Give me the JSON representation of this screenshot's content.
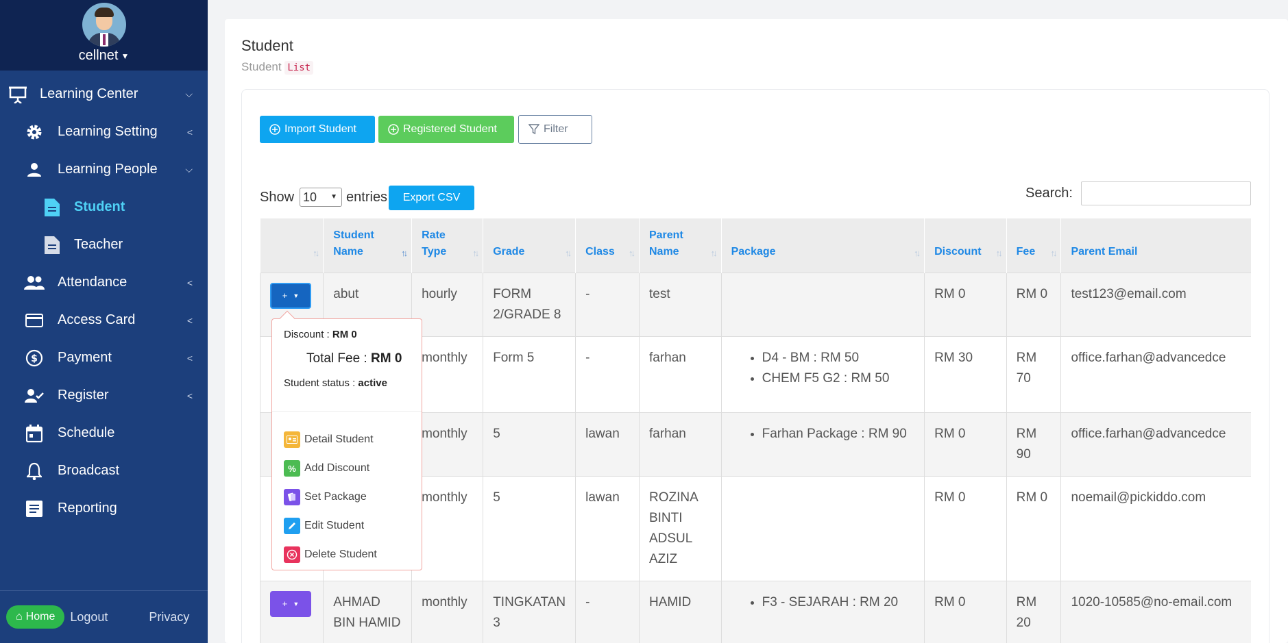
{
  "sidebar": {
    "username": "cellnet",
    "items": [
      {
        "label": "Learning Center"
      },
      {
        "label": "Learning Setting"
      },
      {
        "label": "Learning People"
      },
      {
        "label": "Student"
      },
      {
        "label": "Teacher"
      },
      {
        "label": "Attendance"
      },
      {
        "label": "Access Card"
      },
      {
        "label": "Payment"
      },
      {
        "label": "Register"
      },
      {
        "label": "Schedule"
      },
      {
        "label": "Broadcast"
      },
      {
        "label": "Reporting"
      }
    ],
    "home_label": "Home",
    "logout_label": "Logout",
    "privacy_label": "Privacy",
    "accent_color": "#4fd1f5"
  },
  "page": {
    "title": "Student",
    "subtitle_prefix": "Student",
    "subtitle_code": "List"
  },
  "toolbar": {
    "import_label": "Import Student",
    "registered_label": "Registered Student",
    "filter_label": "Filter",
    "export_label": "Export CSV"
  },
  "entries": {
    "show_label": "Show",
    "value": "10",
    "entries_label": "entries"
  },
  "search": {
    "label": "Search:",
    "value": ""
  },
  "table": {
    "headers": [
      "",
      "Student Name",
      "Rate Type",
      "Grade",
      "Class",
      "Parent Name",
      "Package",
      "Discount",
      "Fee",
      "Parent Email"
    ],
    "rows": [
      {
        "name": "abut",
        "rate": "hourly",
        "grade": "FORM 2/GRADE 8",
        "class": "-",
        "parent": "test",
        "packages": [],
        "discount": "RM 0",
        "fee": "RM 0",
        "email": "test123@email.com"
      },
      {
        "name": "",
        "rate": "monthly",
        "grade": "Form 5",
        "class": "-",
        "parent": "farhan",
        "packages": [
          "D4 - BM : RM 50",
          "CHEM F5 G2 : RM 50"
        ],
        "discount": "RM 30",
        "fee": "RM 70",
        "email": "office.farhan@advancedce"
      },
      {
        "name": "",
        "rate": "monthly",
        "grade": "5",
        "class": "lawan",
        "parent": "farhan",
        "packages": [
          "Farhan Package : RM 90"
        ],
        "discount": "RM 0",
        "fee": "RM 90",
        "email": "office.farhan@advancedce"
      },
      {
        "name": "",
        "rate": "monthly",
        "grade": "5",
        "class": "lawan",
        "parent": "ROZINA BINTI ADSUL AZIZ",
        "packages": [],
        "discount": "RM 0",
        "fee": "RM 0",
        "email": "noemail@pickiddo.com"
      },
      {
        "name": "AHMAD BIN HAMID",
        "rate": "monthly",
        "grade": "TINGKATAN 3",
        "class": "-",
        "parent": "HAMID",
        "packages": [
          "F3 - SEJARAH : RM 20"
        ],
        "discount": "RM 0",
        "fee": "RM 20",
        "email": "1020-10585@no-email.com"
      }
    ],
    "action_label": "+"
  },
  "popover": {
    "discount_label": "Discount :",
    "discount_value": "RM 0",
    "total_label": "Total Fee :",
    "total_value": "RM 0",
    "status_label": "Student status :",
    "status_value": "active",
    "menu": [
      {
        "label": "Detail Student",
        "icon": "id-card-icon",
        "color": "#f4b63a"
      },
      {
        "label": "Add Discount",
        "icon": "percent-icon",
        "color": "#4cbb52"
      },
      {
        "label": "Set Package",
        "icon": "package-icon",
        "color": "#7b52e8"
      },
      {
        "label": "Edit Student",
        "icon": "pencil-icon",
        "color": "#1f9ff0"
      },
      {
        "label": "Delete Student",
        "icon": "close-circle-icon",
        "color": "#e8335d"
      }
    ]
  }
}
